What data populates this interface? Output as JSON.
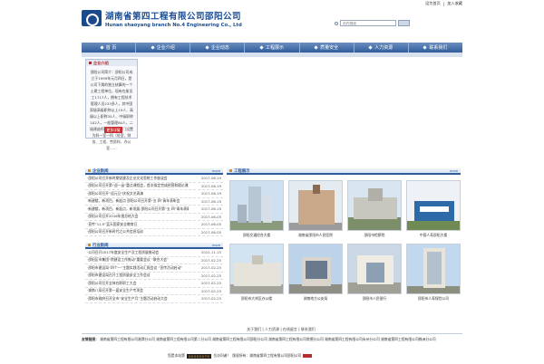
{
  "top_links": [
    "设为首页",
    "加入收藏"
  ],
  "brand": {
    "name_cn": "湖南省第四工程有限公司邵阳公司",
    "name_en": "Hunan shaoyang branch No.4 Engineering Co., Ltd"
  },
  "search": {
    "placeholder": "站内搜索",
    "icon": "search-icon"
  },
  "nav": [
    "首 页",
    "企业介绍",
    "企业动态",
    "工程展示",
    "质量安全",
    "人力资源",
    "联系我们"
  ],
  "intro": {
    "title": "企业介绍",
    "text": "邵阳公司简介：邵阳公司成立于1999年元月四日，是公司下属的独立核算的一个土建工程单位，现有在册员工1717人，拥有工程技术管理人员233多人，其中国家级高级职称以上19人、高级以上职称35人、中级职称102人，一般管理80人，二级建造师46人，各部门设置为科一室一科（处室、财务、工程、劳资科、办公室……",
    "more": "更多详情"
  },
  "news": {
    "title": "企业新闻",
    "more": "more",
    "items": [
      {
        "title": "·邵阳公司召开新时期党建及企业文化思想工作座谈会",
        "date": "2017-06-19"
      },
      {
        "title": "·邵阳公司召开第“迎一亩”重点课程会，首次拟定完成经营和理论课程",
        "date": "2017-06-19"
      },
      {
        "title": "·邵阳公司召开“迎元旦”庆祝文艺表演",
        "date": "2017-06-19"
      },
      {
        "title": "·新建楼，新项目，新起点 邵阳公司召开第“五·四”青年表彰会",
        "date": "2017-06-19"
      },
      {
        "title": "·新建楼，新项目，新起点，新发展 邵阳公司召开第“五·四”青年表彰会",
        "date": "2017-06-19"
      },
      {
        "title": "·邵阳公司召开2016年度总结大会",
        "date": "2017-06-05"
      },
      {
        "title": "·宣传“11.5”蓝天国家安全教育日",
        "date": "2017-06-05"
      },
      {
        "title": "·邵阳公司召开新时代之公共信息培训",
        "date": "2017-06-05"
      }
    ]
  },
  "industry": {
    "title": "行业新闻",
    "more": "more",
    "items": [
      {
        "title": "·公司召开2017年度安全生产及工程质量推动会",
        "date": "2012-11-15"
      },
      {
        "title": "·邵阳区市集团“院建设工作推动”重要会议 “联合大会”",
        "date": "2017-02-25"
      },
      {
        "title": "·邵阳市建设局“四个一”主题实践活动汇报会议 “宣传活动启动”",
        "date": "2017-02-25"
      },
      {
        "title": "·邵阳市建设局召开工程质量安全工作会议",
        "date": "2017-02-25"
      },
      {
        "title": "·邵阳公司召开全体在职职工大会",
        "date": "2017-02-25"
      },
      {
        "title": "·湖南八局召开第一届安全生产专项会",
        "date": "2017-02-25"
      },
      {
        "title": "·邵阳市政府召开全市“安全生产月”主题活动启动大会",
        "date": "2017-02-25"
      }
    ]
  },
  "projects": {
    "title": "工程展示",
    "more": "more",
    "items": [
      {
        "caption": "邵阳交通综合大楼",
        "scene": "tower"
      },
      {
        "caption": "湖南省邵阳市人民医院",
        "scene": "building"
      },
      {
        "caption": "邵阳市检察院",
        "scene": "plaza"
      },
      {
        "caption": "中国人寿邵阳大楼",
        "scene": "gate"
      },
      {
        "caption": "邵阳市大祥区办公楼",
        "scene": "wide"
      },
      {
        "caption": "湖南地方公安局",
        "scene": "office"
      },
      {
        "caption": "邵阳市人民银行",
        "scene": "lobby"
      },
      {
        "caption": "邵阳市人寿保险公司",
        "scene": "highrise"
      }
    ]
  },
  "footer": {
    "nav": "关于我们 | 人力资源 | 在线留言 | 联系我们",
    "links_label": "友情链接：",
    "links": "湖南省第四工程有限公司湘潭分公司  湖南省第四工程有限公司第二分公司  湖南省第四工程有限公司邵阳分公司  湖南省第四工程有限公司常德分公司  湖南省第四工程有限公司永州分公司  湖南省第四工程有限公司株洲分公司",
    "counter_label": "您是本站第",
    "counter": "00000079",
    "counter_suffix": "位访问者！",
    "copyright": "版权所有：湖南省第四工程有限公司邵阳公司"
  }
}
